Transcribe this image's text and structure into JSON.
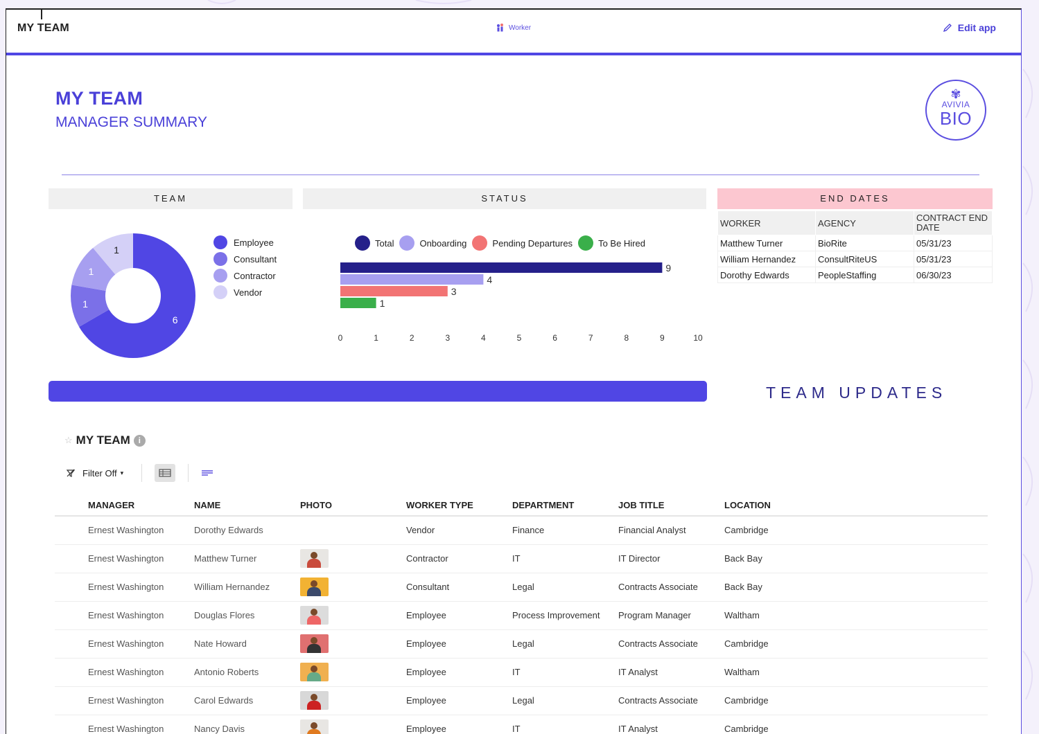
{
  "app": {
    "title": "MY TEAM",
    "brand": "Worker",
    "edit_label": "Edit app"
  },
  "header": {
    "title": "MY TEAM",
    "subtitle": "MANAGER SUMMARY",
    "logo_top": "AVIVIA",
    "logo_bottom": "BIO"
  },
  "panels": {
    "team": "TEAM",
    "status": "STATUS",
    "end_dates": "END DATES",
    "team_updates": "TEAM UPDATES"
  },
  "colors": {
    "accent": "#5046e4",
    "employee": "#5046e4",
    "consultant": "#7b70e8",
    "contractor": "#a79ff0",
    "vendor": "#d4d0f7",
    "total": "#25208a",
    "onboarding": "#a79ff0",
    "pending": "#f27474",
    "to_be_hired": "#3aaf4a"
  },
  "chart_data": [
    {
      "type": "pie",
      "title": "TEAM",
      "categories": [
        "Employee",
        "Consultant",
        "Contractor",
        "Vendor"
      ],
      "values": [
        6,
        1,
        1,
        1
      ],
      "legend": "right"
    },
    {
      "type": "bar",
      "orientation": "horizontal",
      "title": "STATUS",
      "categories": [
        "Total",
        "Onboarding",
        "Pending Departures",
        "To Be Hired"
      ],
      "values": [
        9,
        4,
        3,
        1
      ],
      "xlim": [
        0,
        10
      ],
      "xticks": [
        0,
        1,
        2,
        3,
        4,
        5,
        6,
        7,
        8,
        9,
        10
      ],
      "legend": "top"
    }
  ],
  "end_dates": {
    "columns": [
      "WORKER",
      "AGENCY",
      "CONTRACT END DATE"
    ],
    "rows": [
      [
        "Matthew Turner",
        "BioRite",
        "05/31/23"
      ],
      [
        "William Hernandez",
        "ConsultRiteUS",
        "05/31/23"
      ],
      [
        "Dorothy Edwards",
        "PeopleStaffing",
        "06/30/23"
      ]
    ]
  },
  "grid": {
    "title": "MY TEAM",
    "filter_label": "Filter Off",
    "columns": [
      "MANAGER",
      "NAME",
      "PHOTO",
      "WORKER TYPE",
      "DEPARTMENT",
      "JOB TITLE",
      "LOCATION"
    ],
    "rows": [
      {
        "manager": "Ernest Washington",
        "name": "Dorothy Edwards",
        "photo": "none",
        "worker_type": "Vendor",
        "department": "Finance",
        "job_title": "Financial Analyst",
        "location": "Cambridge"
      },
      {
        "manager": "Ernest Washington",
        "name": "Matthew Turner",
        "photo": "#e8e6e3",
        "worker_type": "Contractor",
        "department": "IT",
        "job_title": "IT Director",
        "location": "Back Bay"
      },
      {
        "manager": "Ernest Washington",
        "name": "William Hernandez",
        "photo": "#f2b233",
        "worker_type": "Consultant",
        "department": "Legal",
        "job_title": "Contracts Associate",
        "location": "Back Bay"
      },
      {
        "manager": "Ernest Washington",
        "name": "Douglas Flores",
        "photo": "#dcdcdc",
        "worker_type": "Employee",
        "department": "Process Improvement",
        "job_title": "Program Manager",
        "location": "Waltham"
      },
      {
        "manager": "Ernest Washington",
        "name": "Nate Howard",
        "photo": "#e07070",
        "worker_type": "Employee",
        "department": "Legal",
        "job_title": "Contracts Associate",
        "location": "Cambridge"
      },
      {
        "manager": "Ernest Washington",
        "name": "Antonio Roberts",
        "photo": "#f0b050",
        "worker_type": "Employee",
        "department": "IT",
        "job_title": "IT Analyst",
        "location": "Waltham"
      },
      {
        "manager": "Ernest Washington",
        "name": "Carol Edwards",
        "photo": "#d8d8d8",
        "worker_type": "Employee",
        "department": "Legal",
        "job_title": "Contracts Associate",
        "location": "Cambridge"
      },
      {
        "manager": "Ernest Washington",
        "name": "Nancy Davis",
        "photo": "#e8e6e3",
        "worker_type": "Employee",
        "department": "IT",
        "job_title": "IT Analyst",
        "location": "Cambridge"
      }
    ]
  }
}
